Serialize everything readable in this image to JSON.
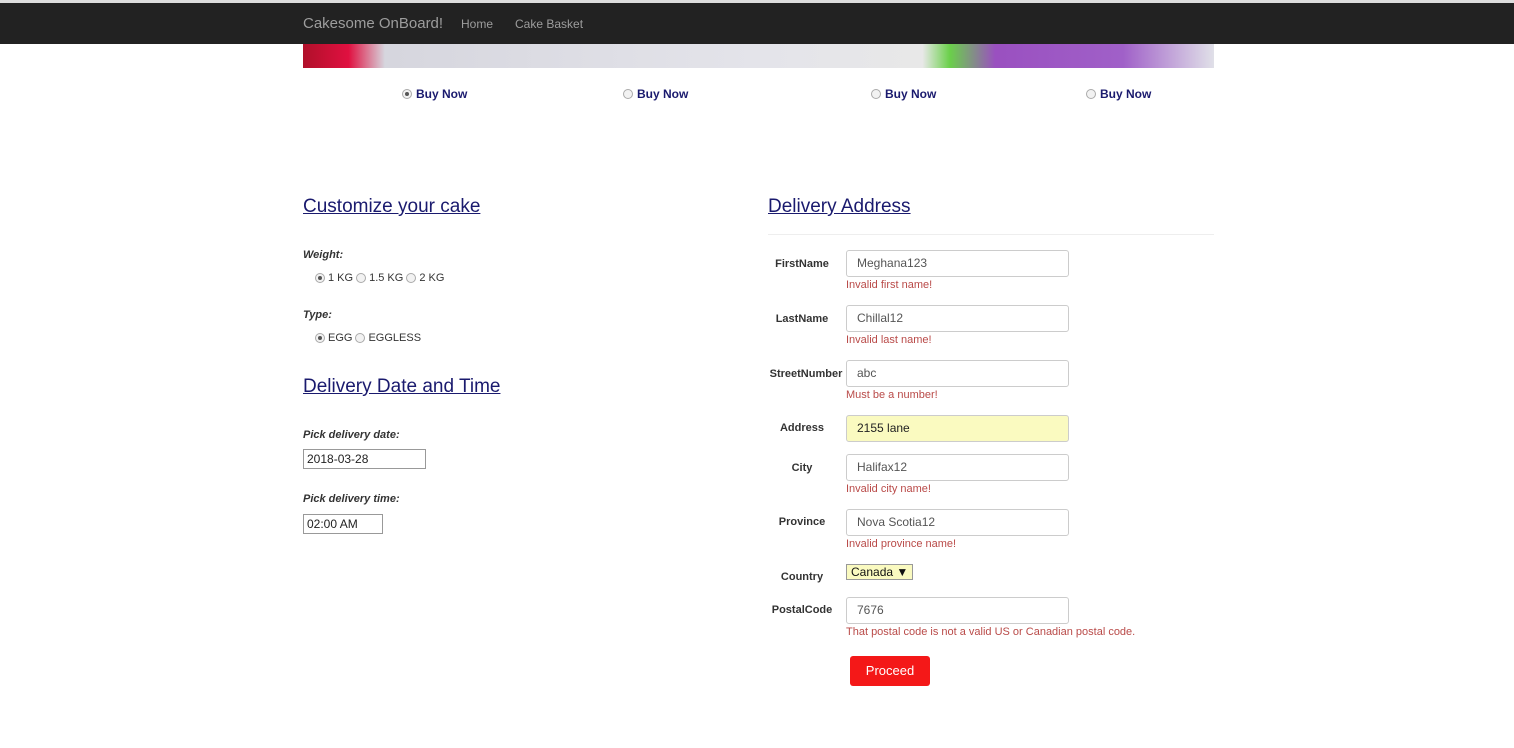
{
  "nav": {
    "brand": "Cakesome OnBoard!",
    "links": [
      "Home",
      "Cake Basket"
    ]
  },
  "products": [
    {
      "label": "Buy Now",
      "selected": true
    },
    {
      "label": "Buy Now",
      "selected": false
    },
    {
      "label": "Buy Now",
      "selected": false
    },
    {
      "label": "Buy Now",
      "selected": false
    }
  ],
  "customize": {
    "title": "Customize your cake",
    "weight_label": "Weight:",
    "weights": [
      "1 KG",
      "1.5 KG",
      "2 KG"
    ],
    "weight_selected": "1 KG",
    "type_label": "Type:",
    "types": [
      "EGG",
      "EGGLESS"
    ],
    "type_selected": "EGG"
  },
  "delivery": {
    "title": "Delivery Date and Time",
    "date_label": "Pick delivery date:",
    "date": "2018-03-28",
    "time_label": "Pick delivery time:",
    "time": "02:00 AM"
  },
  "address": {
    "title": "Delivery Address",
    "fields": [
      {
        "label": "FirstName",
        "value": "Meghana123",
        "error": "Invalid first name!"
      },
      {
        "label": "LastName",
        "value": "Chillal12",
        "error": "Invalid last name!"
      },
      {
        "label": "StreetNumber",
        "value": "abc",
        "error": "Must be a number!"
      },
      {
        "label": "Address",
        "value": "2155 lane",
        "error": ""
      },
      {
        "label": "City",
        "value": "Halifax12",
        "error": "Invalid city name!"
      },
      {
        "label": "Province",
        "value": "Nova Scotia12",
        "error": "Invalid province name!"
      },
      {
        "label": "PostalCode",
        "value": "7676",
        "error": "That postal code is not a valid US or Canadian postal code."
      }
    ],
    "country_label": "Country",
    "country": "Canada",
    "proceed": "Proceed"
  },
  "colors": {
    "navbar": "#222222",
    "accent": "#1a1a6e",
    "error": "#b94a48",
    "button": "#f41818",
    "autofill": "#fafac0"
  }
}
